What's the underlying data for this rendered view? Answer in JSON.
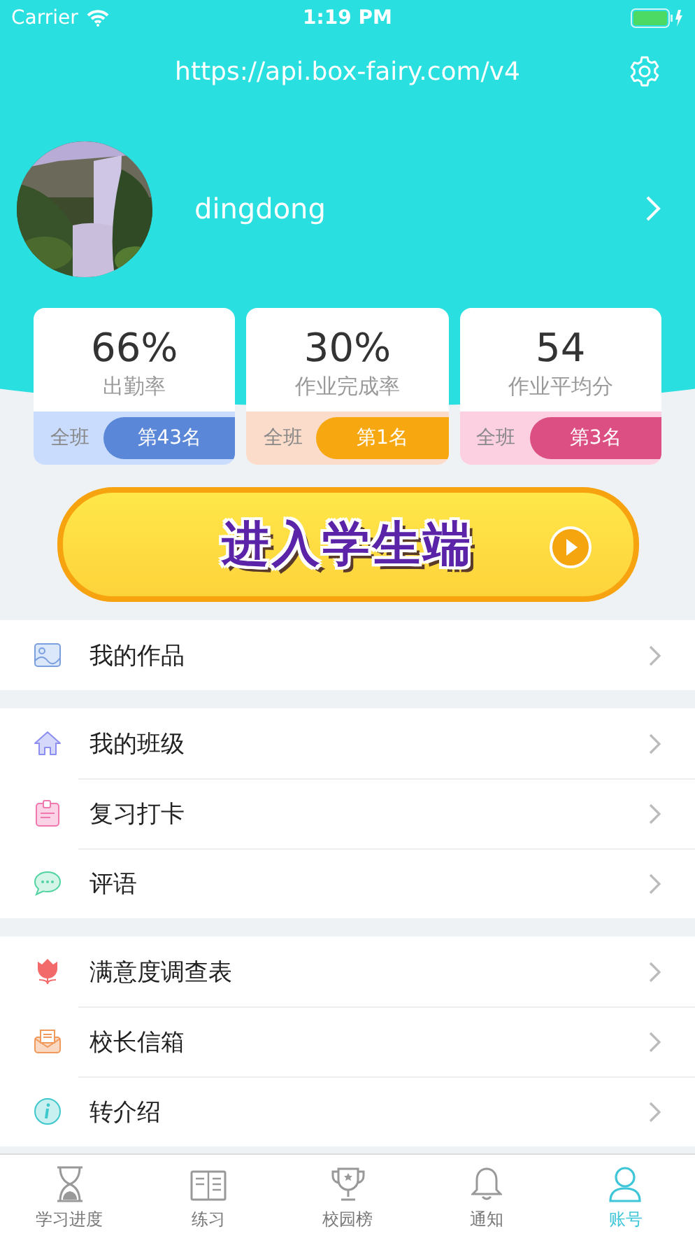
{
  "status_bar": {
    "carrier": "Carrier",
    "time": "1:19 PM"
  },
  "header": {
    "url": "https://api.box-fairy.com/v4"
  },
  "profile": {
    "name": "dingdong"
  },
  "stats": [
    {
      "value": "66%",
      "label": "出勤率",
      "scope": "全班",
      "rank": "第43名",
      "color": "#5b87d8"
    },
    {
      "value": "30%",
      "label": "作业完成率",
      "scope": "全班",
      "rank": "第1名",
      "color": "#f7a811"
    },
    {
      "value": "54",
      "label": "作业平均分",
      "scope": "全班",
      "rank": "第3名",
      "color": "#dc4f82"
    }
  ],
  "student_button": {
    "label": "进入学生端"
  },
  "menu_groups": [
    [
      {
        "label": "我的作品"
      }
    ],
    [
      {
        "label": "我的班级"
      },
      {
        "label": "复习打卡"
      },
      {
        "label": "评语"
      }
    ],
    [
      {
        "label": "满意度调查表"
      },
      {
        "label": "校长信箱"
      },
      {
        "label": "转介绍"
      }
    ]
  ],
  "tabs": [
    {
      "label": "学习进度",
      "selected": false
    },
    {
      "label": "练习",
      "selected": false
    },
    {
      "label": "校园榜",
      "selected": false
    },
    {
      "label": "通知",
      "selected": false
    },
    {
      "label": "账号",
      "selected": true
    }
  ]
}
